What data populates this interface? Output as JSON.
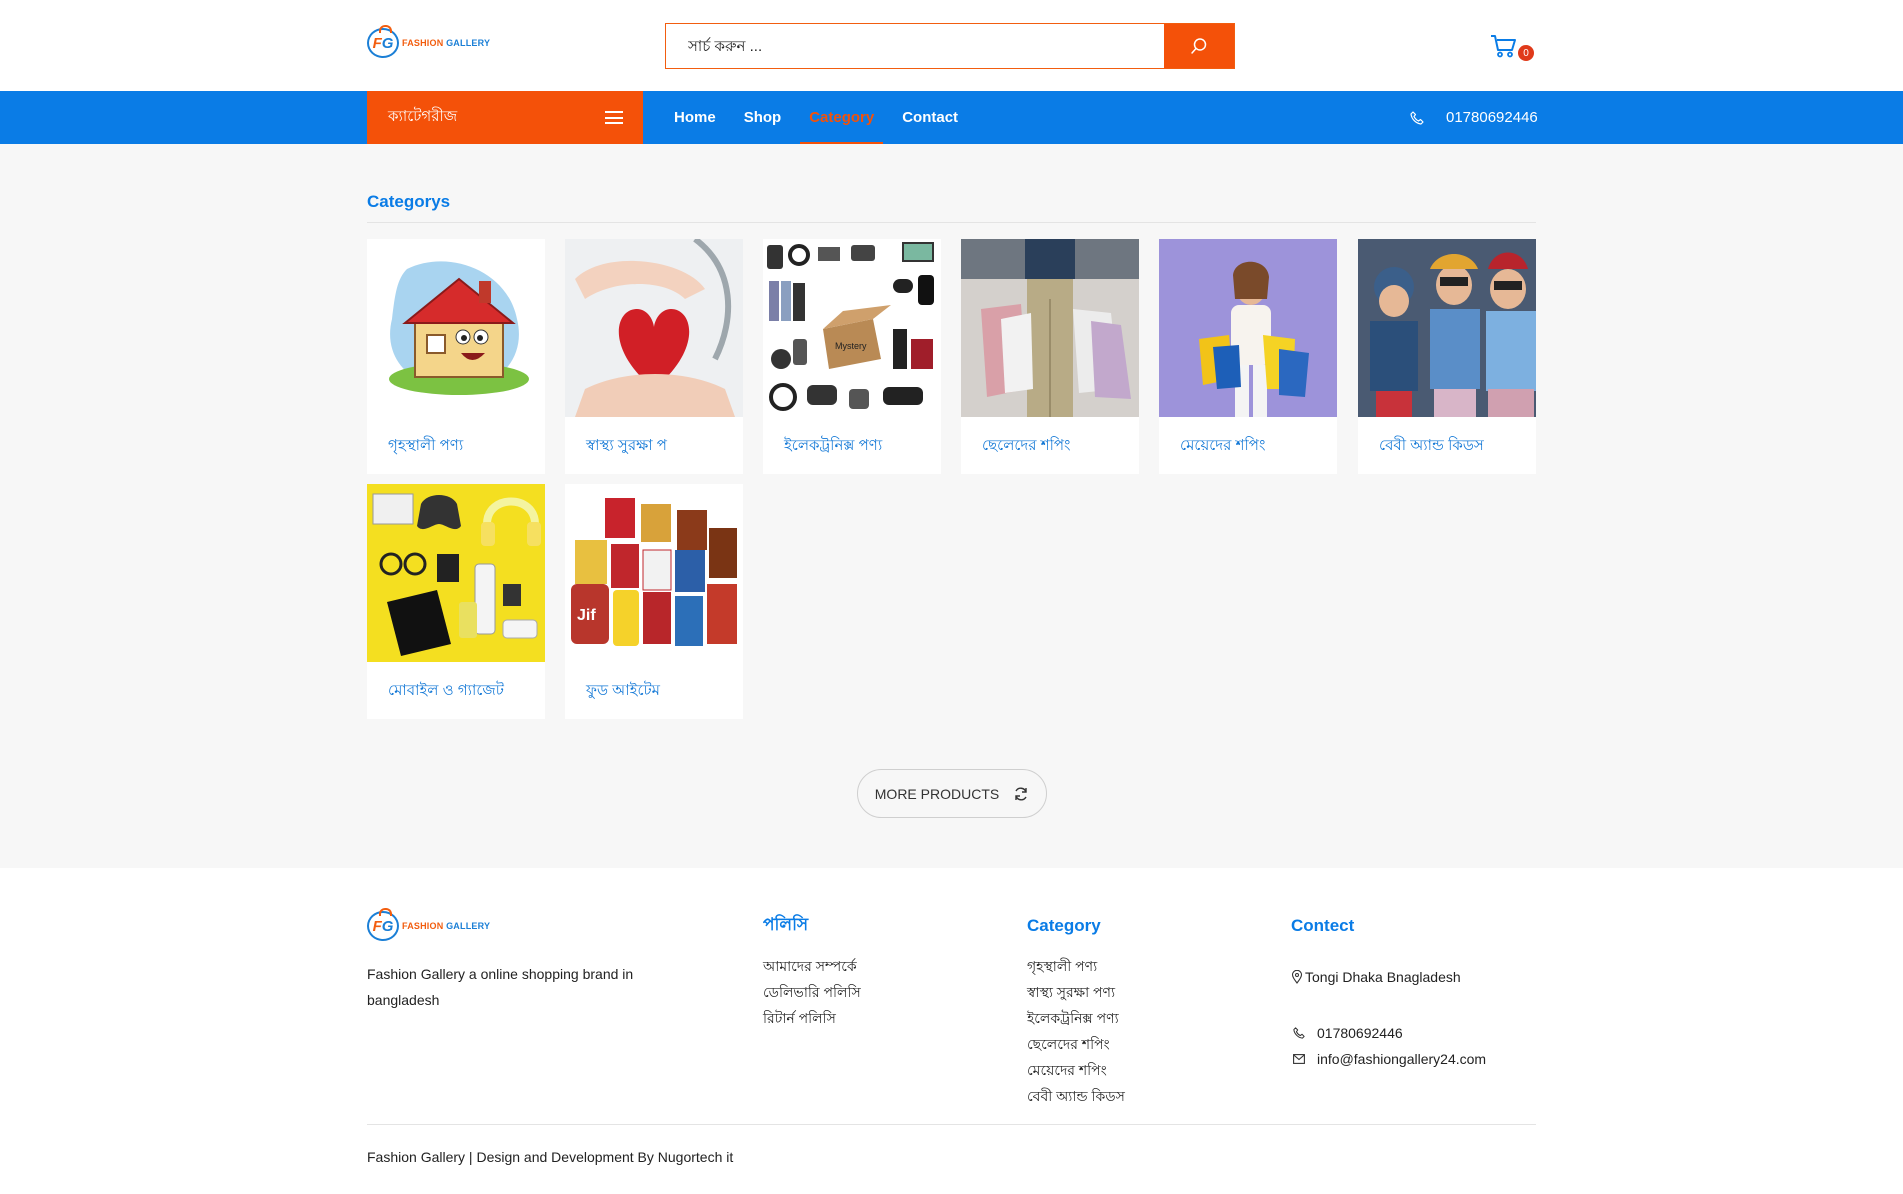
{
  "brand": {
    "logo_letters_1": "F",
    "logo_letters_2": "G",
    "name_part1": "FASHION",
    "name_part2": "GALLERY"
  },
  "header": {
    "search_placeholder": "সার্চ করুন ...",
    "cart_count": "0"
  },
  "nav": {
    "category_toggle": "ক্যাটেগরীজ",
    "links": [
      "Home",
      "Shop",
      "Category",
      "Contact"
    ],
    "active_link": "Category",
    "phone": "01780692446"
  },
  "main": {
    "section_title": "Categorys",
    "categories": [
      {
        "label": "গৃহস্থালী পণ্য",
        "image": "house-cartoon"
      },
      {
        "label": "স্বাস্থ্য সুরক্ষা প",
        "image": "heart-stethoscope"
      },
      {
        "label": "ইলেকট্রনিক্স পণ্য",
        "image": "electronics-collage"
      },
      {
        "label": "ছেলেদের শপিং",
        "image": "man-shopping-bags"
      },
      {
        "label": "মেয়েদের শপিং",
        "image": "woman-shopping-bags"
      },
      {
        "label": "বেবী অ্যান্ড কিডস",
        "image": "kids"
      },
      {
        "label": "মোবাইল ও গ্যাজেট",
        "image": "gadgets-yellow"
      },
      {
        "label": "ফুড আইটেম",
        "image": "food-jars"
      }
    ],
    "more_button": "MORE PRODUCTS"
  },
  "footer": {
    "about": "Fashion Gallery a online shopping brand in bangladesh",
    "policy_title": "পলিসি",
    "policy_links": [
      "আমাদের সম্পর্কে",
      "ডেলিভারি পলিসি",
      "রিটার্ন পলিসি"
    ],
    "category_title": "Category",
    "category_links": [
      "গৃহস্থালী পণ্য",
      "স্বাস্থ্য সুরক্ষা পণ্য",
      "ইলেকট্রনিক্স পণ্য",
      "ছেলেদের শপিং",
      "মেয়েদের শপিং",
      "বেবী অ্যান্ড কিডস"
    ],
    "contact_title": "Contect",
    "address": "Tongi Dhaka Bnagladesh",
    "phone": "01780692446",
    "email": "info@fashiongallery24.com",
    "copyright": "Fashion Gallery | Design and Development By Nugortech it"
  },
  "colors": {
    "primary": "#0a7ce6",
    "accent": "#f45109"
  },
  "icons": [
    "search-icon",
    "cart-icon",
    "hamburger-icon",
    "phone-icon",
    "refresh-icon",
    "location-icon",
    "mail-icon"
  ]
}
